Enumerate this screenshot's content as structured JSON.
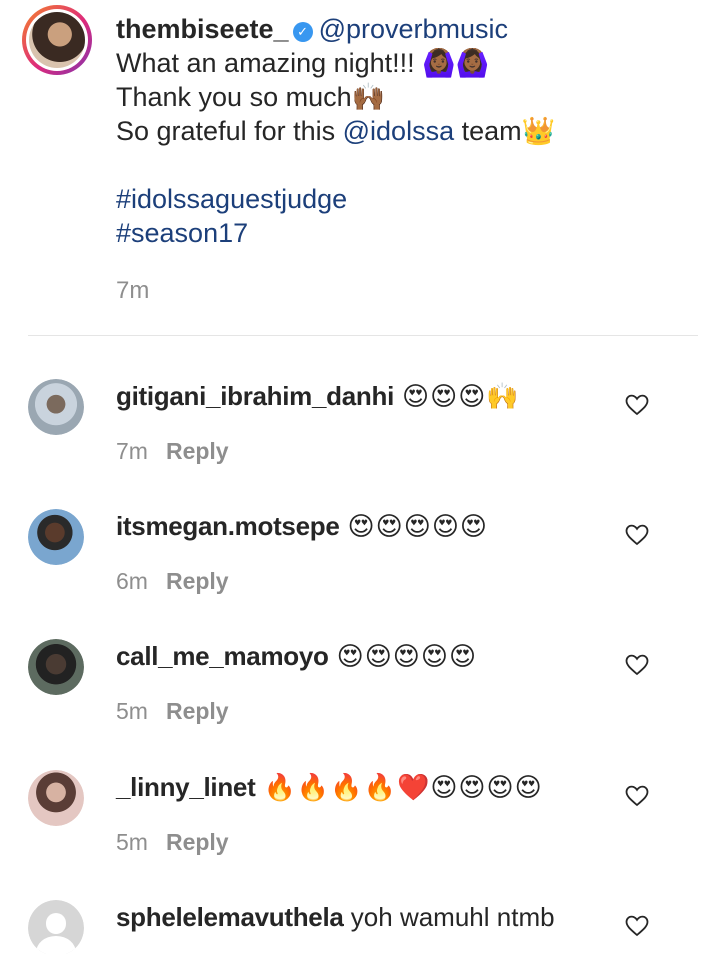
{
  "post": {
    "username": "thembiseete_",
    "verified": true,
    "lines": [
      {
        "prefix": "",
        "mention": "@proverbmusic",
        "suffix": ""
      },
      {
        "text": "What an amazing night!!! 🙆🏾‍♀️🙆🏾‍♀️"
      },
      {
        "text": "Thank you so much🙌🏾"
      },
      {
        "prefix": "So grateful for this ",
        "mention": "@idolssa",
        "suffix": " team👑"
      }
    ],
    "hashtags": [
      "#idolssaguestjudge",
      "#season17"
    ],
    "time": "7m"
  },
  "comments": [
    {
      "username": "gitigani_ibrahim_danhi",
      "text": "😍😍😍🙌",
      "time": "7m",
      "reply_label": "Reply"
    },
    {
      "username": "itsmegan.motsepe",
      "text": "😍😍😍😍😍",
      "time": "6m",
      "reply_label": "Reply"
    },
    {
      "username": "call_me_mamoyo",
      "text": "😍😍😍😍😍",
      "time": "5m",
      "reply_label": "Reply"
    },
    {
      "username": "_linny_linet",
      "text": "🔥🔥🔥🔥❤️😍😍😍😍",
      "time": "5m",
      "reply_label": "Reply"
    },
    {
      "username": "sphelelemavuthela",
      "text": "yoh wamuhl ntmb",
      "time": "",
      "reply_label": ""
    }
  ],
  "icons": {
    "like": "heart-outline-icon",
    "verified": "verified-badge-icon"
  },
  "colors": {
    "link": "#1c3f7a",
    "muted": "#8e8e8e",
    "text": "#262626",
    "verified": "#3897f0"
  }
}
